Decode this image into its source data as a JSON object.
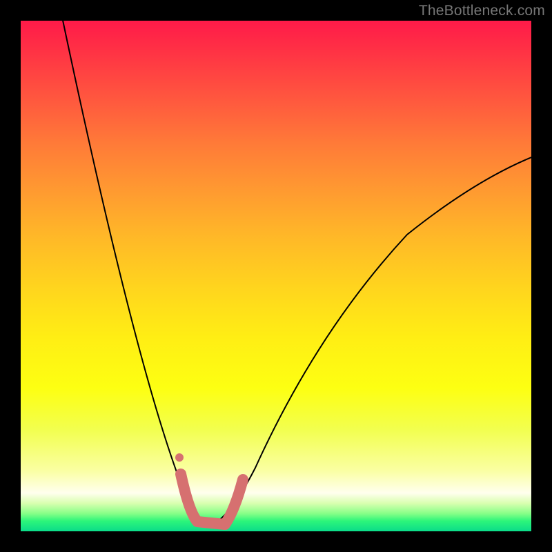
{
  "watermark": "TheBottleneck.com",
  "chart_data": {
    "type": "line",
    "title": "",
    "xlabel": "",
    "ylabel": "",
    "xlim": [
      0,
      100
    ],
    "ylim": [
      0,
      100
    ],
    "grid": false,
    "series": [
      {
        "name": "bottleneck-curve",
        "x_optimum": 37,
        "left_branch": {
          "x0": 8,
          "y": 100
        },
        "right_branch": {
          "x1": 100,
          "y": 68
        },
        "stroke": "#000000",
        "stroke_width": 2
      },
      {
        "name": "highlight-segment",
        "points": [
          {
            "x": 31.5,
            "y": 11
          },
          {
            "x": 32.5,
            "y": 6.5
          },
          {
            "x": 34,
            "y": 2.0
          },
          {
            "x": 37,
            "y": 0.6
          },
          {
            "x": 40,
            "y": 1.8
          },
          {
            "x": 42,
            "y": 5.0
          },
          {
            "x": 43.5,
            "y": 9.8
          }
        ],
        "stroke": "#d67070",
        "stroke_width": 12,
        "dot": {
          "x": 31.5,
          "y": 14.5,
          "r": 4.5
        }
      }
    ],
    "gradient_stops": [
      {
        "pos": 0,
        "color": "#ff1a49"
      },
      {
        "pos": 0.33,
        "color": "#ff9931"
      },
      {
        "pos": 0.62,
        "color": "#ffee14"
      },
      {
        "pos": 0.92,
        "color": "#ffffee"
      },
      {
        "pos": 1.0,
        "color": "#0bdc8a"
      }
    ]
  }
}
